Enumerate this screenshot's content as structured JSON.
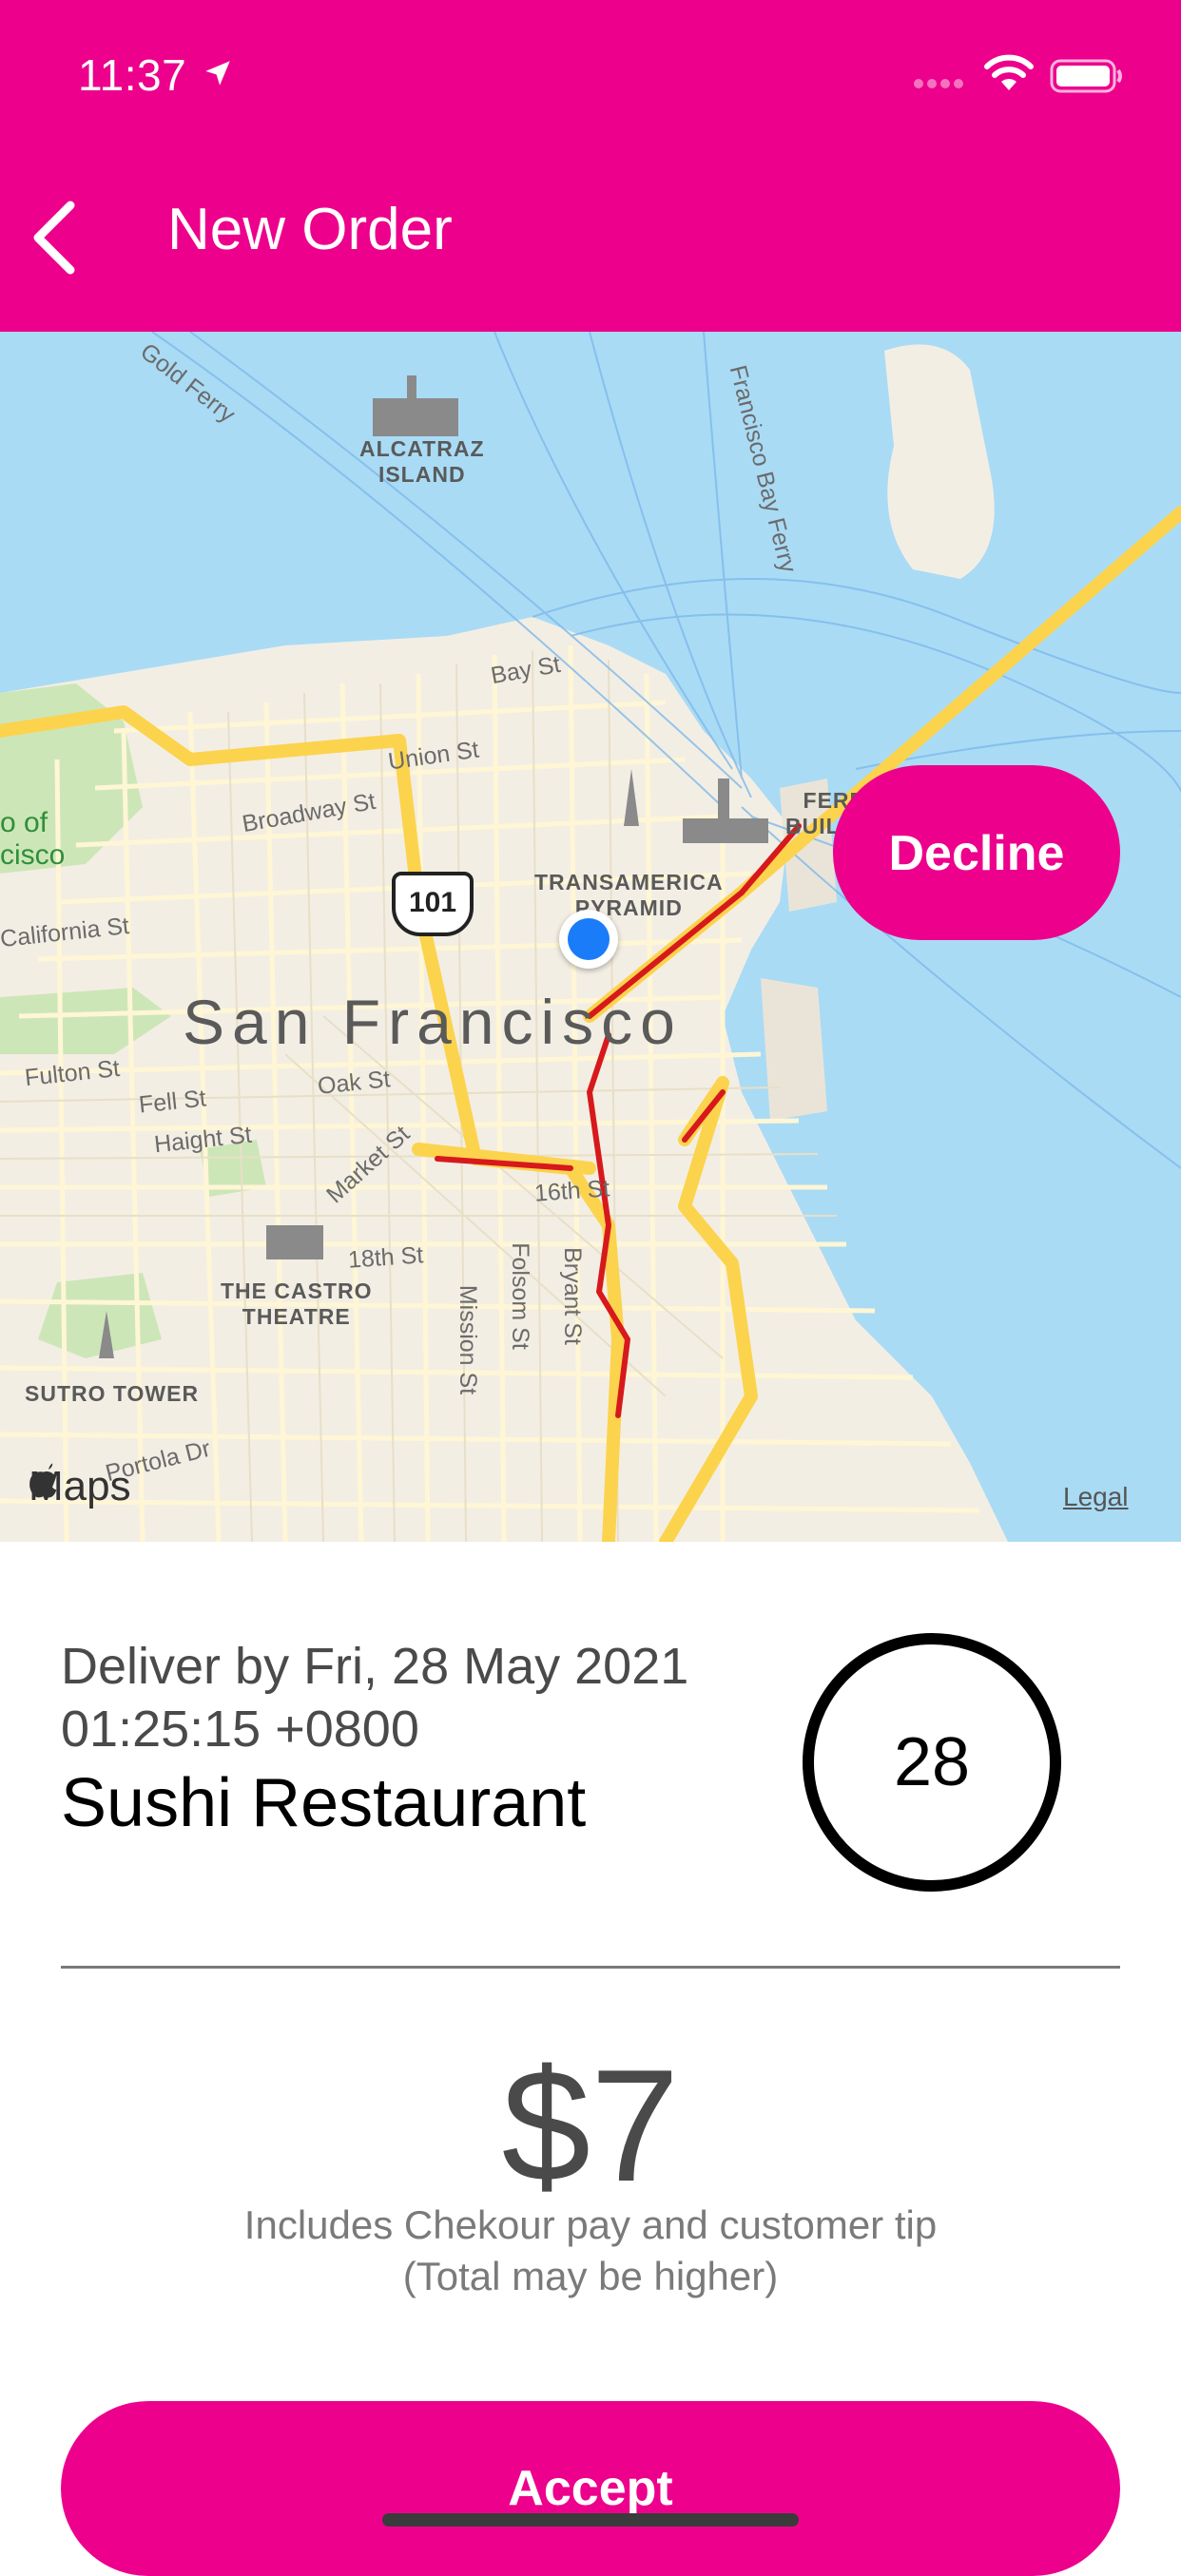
{
  "status_bar": {
    "time": "11:37",
    "icons": [
      "location-arrow-icon",
      "cellular-signal-icon",
      "wifi-icon",
      "battery-icon"
    ]
  },
  "nav": {
    "title": "New Order",
    "back_icon": "chevron-left-icon"
  },
  "map": {
    "city_label": "San Francisco",
    "streets": [
      "Bay St",
      "Union St",
      "Broadway St",
      "California St",
      "Fulton St",
      "Fell St",
      "Oak St",
      "Haight St",
      "Market St",
      "18th St",
      "16th St",
      "Folsom St",
      "Bryant St",
      "Mission St",
      "Gold Ferry",
      "Francisco Bay Ferry",
      "Portola Dr"
    ],
    "pois": {
      "alcatraz": "ALCATRAZ\nISLAND",
      "transamerica": "TRANSAMERICA\nPYRAMID",
      "ferry": "FERRY\nBUILDING",
      "castro": "THE CASTRO\nTHEATRE",
      "sutro": "SUTRO TOWER"
    },
    "park_label": "o of\ncisco",
    "highway": "101",
    "attribution": "Maps",
    "legal": "Legal"
  },
  "decline_label": "Decline",
  "order": {
    "deliver_by": "Deliver by Fri, 28 May 2021 01:25:15 +0800",
    "restaurant": "Sushi Restaurant",
    "countdown": "28"
  },
  "payout": {
    "amount": "$7",
    "note_line1": "Includes Chekour pay and customer tip",
    "note_line2": "(Total may be higher)"
  },
  "accept_label": "Accept",
  "colors": {
    "brand": "#EC008C",
    "water": "#A9DBF5",
    "land": "#F3EEE4",
    "park": "#CDE6B8",
    "road_major": "#FCD34D",
    "traffic": "#D7191C",
    "user_location": "#1A7CF8"
  }
}
